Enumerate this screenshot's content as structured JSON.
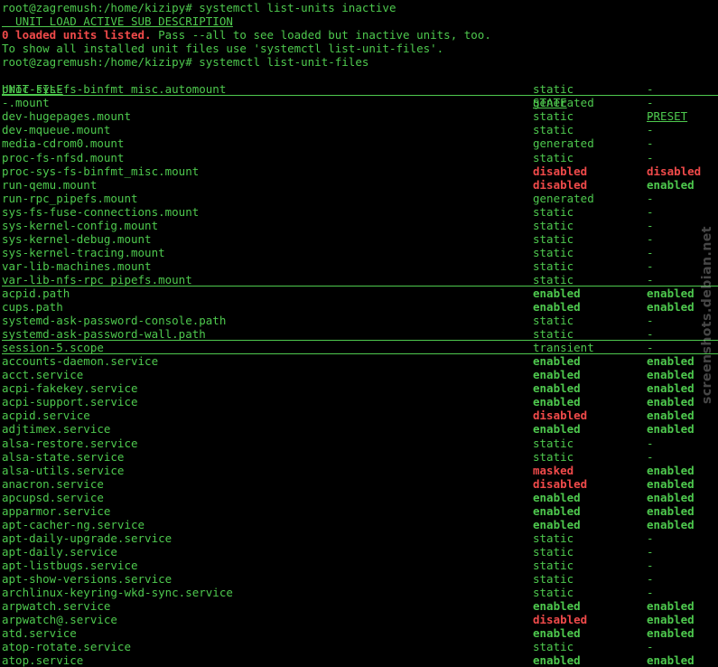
{
  "preamble": {
    "cmd1": "root@zagremush:/home/kizipy# systemctl list-units inactive",
    "header1": "  UNIT LOAD ACTIVE SUB DESCRIPTION",
    "warn_bold": "0 loaded units listed.",
    "warn_rest": " Pass --all to see loaded but inactive units, too.",
    "hint": "To show all installed unit files use 'systemctl list-unit-files'.",
    "cmd2": "root@zagremush:/home/kizipy# systemctl list-unit-files"
  },
  "table": {
    "headers": {
      "unit": "UNIT FILE",
      "state": "STATE",
      "preset": "PRESET"
    },
    "rows": [
      {
        "unit": "proc-sys-fs-binfmt_misc.automount",
        "state": "static",
        "preset": "-",
        "group_end": true
      },
      {
        "unit": "-.mount",
        "state": "generated",
        "preset": "-"
      },
      {
        "unit": "dev-hugepages.mount",
        "state": "static",
        "preset": "-"
      },
      {
        "unit": "dev-mqueue.mount",
        "state": "static",
        "preset": "-"
      },
      {
        "unit": "media-cdrom0.mount",
        "state": "generated",
        "preset": "-"
      },
      {
        "unit": "proc-fs-nfsd.mount",
        "state": "static",
        "preset": "-"
      },
      {
        "unit": "proc-sys-fs-binfmt_misc.mount",
        "state": "disabled",
        "preset": "disabled"
      },
      {
        "unit": "run-qemu.mount",
        "state": "disabled",
        "preset": "enabled"
      },
      {
        "unit": "run-rpc_pipefs.mount",
        "state": "generated",
        "preset": "-"
      },
      {
        "unit": "sys-fs-fuse-connections.mount",
        "state": "static",
        "preset": "-"
      },
      {
        "unit": "sys-kernel-config.mount",
        "state": "static",
        "preset": "-"
      },
      {
        "unit": "sys-kernel-debug.mount",
        "state": "static",
        "preset": "-"
      },
      {
        "unit": "sys-kernel-tracing.mount",
        "state": "static",
        "preset": "-"
      },
      {
        "unit": "var-lib-machines.mount",
        "state": "static",
        "preset": "-"
      },
      {
        "unit": "var-lib-nfs-rpc_pipefs.mount",
        "state": "static",
        "preset": "-",
        "group_end": true
      },
      {
        "unit": "acpid.path",
        "state": "enabled",
        "preset": "enabled"
      },
      {
        "unit": "cups.path",
        "state": "enabled",
        "preset": "enabled"
      },
      {
        "unit": "systemd-ask-password-console.path",
        "state": "static",
        "preset": "-"
      },
      {
        "unit": "systemd-ask-password-wall.path",
        "state": "static",
        "preset": "-",
        "group_end": true
      },
      {
        "unit": "session-5.scope",
        "state": "transient",
        "preset": "-",
        "group_end": true
      },
      {
        "unit": "accounts-daemon.service",
        "state": "enabled",
        "preset": "enabled"
      },
      {
        "unit": "acct.service",
        "state": "enabled",
        "preset": "enabled"
      },
      {
        "unit": "acpi-fakekey.service",
        "state": "enabled",
        "preset": "enabled"
      },
      {
        "unit": "acpi-support.service",
        "state": "enabled",
        "preset": "enabled"
      },
      {
        "unit": "acpid.service",
        "state": "disabled",
        "preset": "enabled"
      },
      {
        "unit": "adjtimex.service",
        "state": "enabled",
        "preset": "enabled"
      },
      {
        "unit": "alsa-restore.service",
        "state": "static",
        "preset": "-"
      },
      {
        "unit": "alsa-state.service",
        "state": "static",
        "preset": "-"
      },
      {
        "unit": "alsa-utils.service",
        "state": "masked",
        "preset": "enabled"
      },
      {
        "unit": "anacron.service",
        "state": "disabled",
        "preset": "enabled"
      },
      {
        "unit": "apcupsd.service",
        "state": "enabled",
        "preset": "enabled"
      },
      {
        "unit": "apparmor.service",
        "state": "enabled",
        "preset": "enabled"
      },
      {
        "unit": "apt-cacher-ng.service",
        "state": "enabled",
        "preset": "enabled"
      },
      {
        "unit": "apt-daily-upgrade.service",
        "state": "static",
        "preset": "-"
      },
      {
        "unit": "apt-daily.service",
        "state": "static",
        "preset": "-"
      },
      {
        "unit": "apt-listbugs.service",
        "state": "static",
        "preset": "-"
      },
      {
        "unit": "apt-show-versions.service",
        "state": "static",
        "preset": "-"
      },
      {
        "unit": "archlinux-keyring-wkd-sync.service",
        "state": "static",
        "preset": "-"
      },
      {
        "unit": "arpwatch.service",
        "state": "enabled",
        "preset": "enabled"
      },
      {
        "unit": "arpwatch@.service",
        "state": "disabled",
        "preset": "enabled"
      },
      {
        "unit": "atd.service",
        "state": "enabled",
        "preset": "enabled"
      },
      {
        "unit": "atop-rotate.service",
        "state": "static",
        "preset": "-"
      },
      {
        "unit": "atop.service",
        "state": "enabled",
        "preset": "enabled"
      }
    ]
  },
  "watermark": "screenshots.debian.net",
  "colors": {
    "fg": "#4ec94e",
    "error": "#f04a4a",
    "bg": "#000000"
  }
}
